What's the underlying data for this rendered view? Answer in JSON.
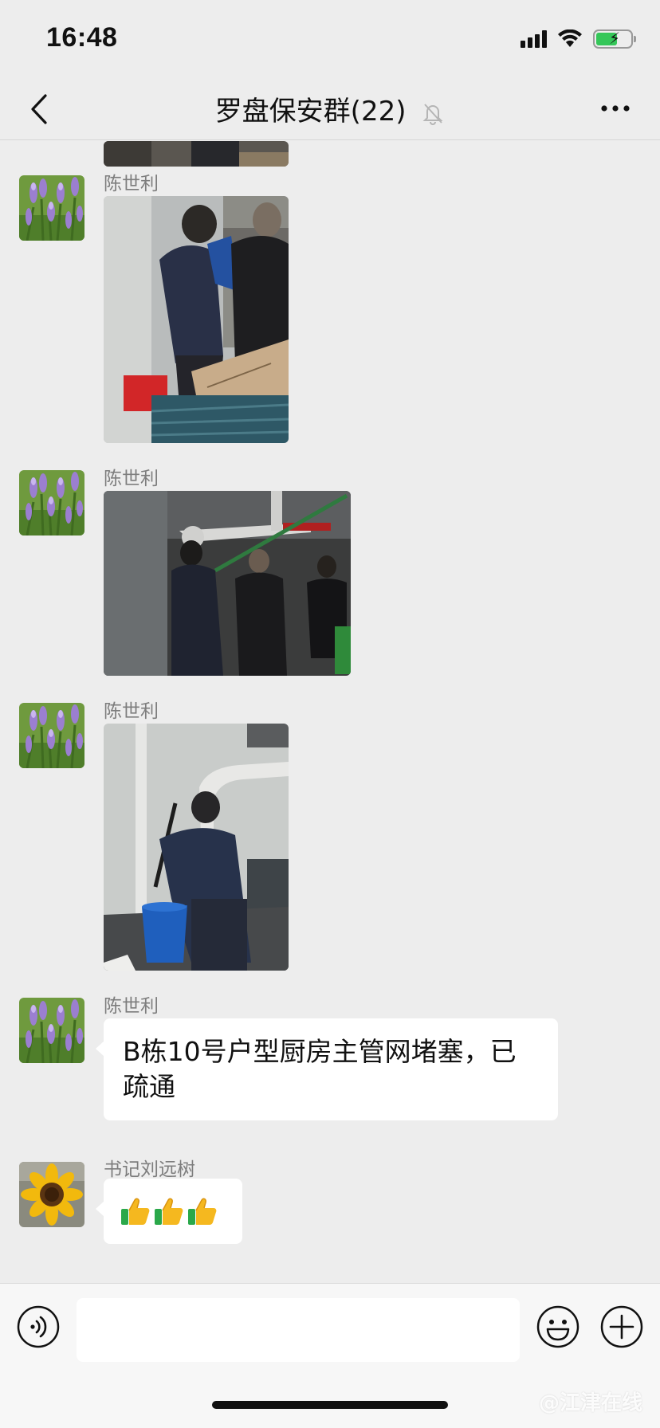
{
  "status_bar": {
    "time": "16:48",
    "icons": [
      "signal-icon",
      "wifi-icon",
      "battery-charging-icon"
    ],
    "battery_color": "#35c759"
  },
  "nav": {
    "title": "罗盘保安群(22)",
    "icons": [
      "back-icon",
      "mute-bell-icon",
      "more-icon"
    ]
  },
  "messages": [
    {
      "sender": "陈世利",
      "type": "image",
      "avatar": "lavender-flowers"
    },
    {
      "sender": "陈世利",
      "type": "image",
      "avatar": "lavender-flowers"
    },
    {
      "sender": "陈世利",
      "type": "image",
      "avatar": "lavender-flowers"
    },
    {
      "sender": "陈世利",
      "type": "text",
      "avatar": "lavender-flowers",
      "text": "B栋10号户型厨房主管网堵塞，已疏通"
    },
    {
      "sender": "书记刘远树",
      "type": "emoji",
      "avatar": "sunflower",
      "emoji": "thumbs-up ×3"
    }
  ],
  "input_bar": {
    "icons": [
      "voice-icon",
      "emoji-icon",
      "plus-icon"
    ],
    "value": ""
  },
  "watermark": "@江津在线",
  "colors": {
    "background": "#ededed",
    "bubble": "#ffffff",
    "sender_name": "#7d7d7d"
  }
}
